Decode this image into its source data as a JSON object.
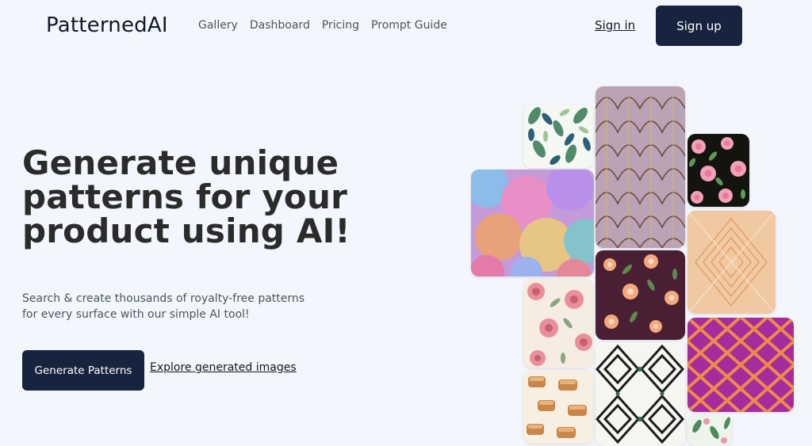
{
  "header": {
    "logo": "PatternedAI",
    "nav": [
      "Gallery",
      "Dashboard",
      "Pricing",
      "Prompt Guide"
    ],
    "sign_in": "Sign in",
    "sign_up": "Sign up"
  },
  "hero": {
    "title_lines": [
      "Generate unique",
      "patterns for your",
      "product using AI!"
    ],
    "subtitle_lines": [
      "Search & create thousands of royalty-free patterns",
      "for every surface with our simple AI tool!"
    ],
    "cta_label": "Generate Patterns",
    "explore_label": "Explore generated images"
  },
  "colors": {
    "background": "#f3f6fd",
    "button": "#172440",
    "text": "#2b2b2b"
  }
}
